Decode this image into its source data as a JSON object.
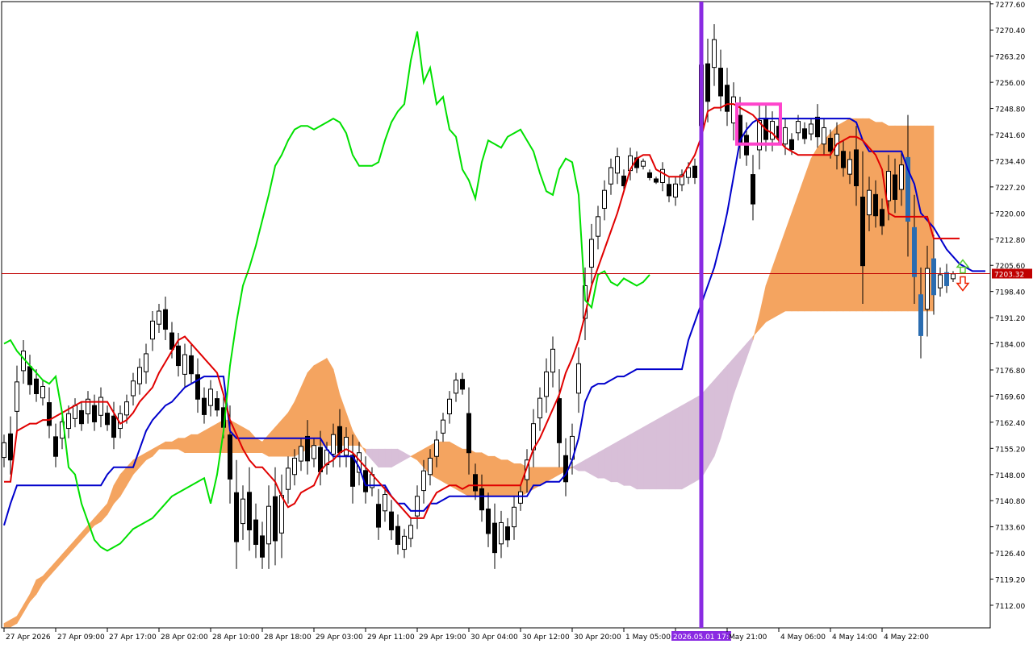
{
  "chart_data": {
    "type": "candlestick",
    "indicator": "Ichimoku Kinko Hyo",
    "ylim": [
      7106.0,
      7278.0
    ],
    "current_price": 7203.32,
    "current_price_label": "7203.32",
    "y_ticks": [
      "7277.60",
      "7270.40",
      "7263.20",
      "7256.00",
      "7248.80",
      "7241.60",
      "7234.40",
      "7227.20",
      "7220.00",
      "7212.80",
      "7205.60",
      "7198.40",
      "7191.20",
      "7184.00",
      "7176.80",
      "7169.60",
      "7162.40",
      "7155.20",
      "7148.00",
      "7140.80",
      "7133.60",
      "7126.40",
      "7119.20",
      "7112.00"
    ],
    "x_ticks": [
      "27 Apr 2026",
      "27 Apr 09:00",
      "27 Apr 17:00",
      "28 Apr 02:00",
      "28 Apr 10:00",
      "28 Apr 18:00",
      "29 Apr 03:00",
      "29 Apr 11:00",
      "29 Apr 19:00",
      "30 Apr 04:00",
      "30 Apr 12:00",
      "30 Apr 20:00",
      "1 May 05:00",
      "2026.05.01 17:00",
      "May 21:00",
      "4 May 06:00",
      "4 May 14:00",
      "4 May 22:00"
    ],
    "x_tick_slots": [
      0,
      8,
      16,
      24,
      32,
      40,
      48,
      56,
      64,
      72,
      80,
      88,
      96,
      104,
      112,
      120,
      128,
      136
    ],
    "cursor_slot": 108,
    "cursor_label": "2026.05.01 17:00",
    "total_slots": 153,
    "colors": {
      "tenkan": "#e00000",
      "kijun": "#0000cc",
      "chikou": "#00e000",
      "kumo_bull": "#f4a460",
      "kumo_bear": "#d8bfd8",
      "cursor": "#8a2be2",
      "price_line": "#c00000",
      "box": "#ff44cc",
      "arrow_up": "#55cc33",
      "arrow_down": "#ee2200",
      "axis_text": "#000000"
    },
    "candles_hl": [
      [
        7159,
        7150
      ],
      [
        7164,
        7148
      ],
      [
        7178,
        7160
      ],
      [
        7185,
        7173
      ],
      [
        7181,
        7170
      ],
      [
        7177,
        7168
      ],
      [
        7174,
        7167
      ],
      [
        7172,
        7158
      ],
      [
        7162,
        7150
      ],
      [
        7165,
        7155
      ],
      [
        7167,
        7158
      ],
      [
        7169,
        7161
      ],
      [
        7168,
        7160
      ],
      [
        7171,
        7162
      ],
      [
        7170,
        7160
      ],
      [
        7172,
        7161
      ],
      [
        7167,
        7160
      ],
      [
        7168,
        7155
      ],
      [
        7167,
        7158
      ],
      [
        7170,
        7162
      ],
      [
        7176,
        7167
      ],
      [
        7180,
        7170
      ],
      [
        7184,
        7173
      ],
      [
        7193,
        7182
      ],
      [
        7195,
        7187
      ],
      [
        7197,
        7185
      ],
      [
        7190,
        7180
      ],
      [
        7187,
        7175
      ],
      [
        7184,
        7172
      ],
      [
        7184,
        7173
      ],
      [
        7180,
        7165
      ],
      [
        7172,
        7162
      ],
      [
        7174,
        7164
      ],
      [
        7171,
        7164
      ],
      [
        7170,
        7158
      ],
      [
        7167,
        7140
      ],
      [
        7152,
        7122
      ],
      [
        7145,
        7130
      ],
      [
        7150,
        7127
      ],
      [
        7140,
        7125
      ],
      [
        7135,
        7122
      ],
      [
        7145,
        7122
      ],
      [
        7150,
        7123
      ],
      [
        7148,
        7125
      ],
      [
        7153,
        7140
      ],
      [
        7155,
        7145
      ],
      [
        7158,
        7149
      ],
      [
        7163,
        7148
      ],
      [
        7158,
        7150
      ],
      [
        7160,
        7145
      ],
      [
        7157,
        7148
      ],
      [
        7162,
        7150
      ],
      [
        7166,
        7150
      ],
      [
        7161,
        7150
      ],
      [
        7159,
        7140
      ],
      [
        7157,
        7145
      ],
      [
        7153,
        7140
      ],
      [
        7150,
        7142
      ],
      [
        7144,
        7130
      ],
      [
        7145,
        7135
      ],
      [
        7141,
        7130
      ],
      [
        7137,
        7126
      ],
      [
        7133,
        7125
      ],
      [
        7136,
        7128
      ],
      [
        7145,
        7133
      ],
      [
        7152,
        7140
      ],
      [
        7155,
        7145
      ],
      [
        7160,
        7150
      ],
      [
        7165,
        7157
      ],
      [
        7171,
        7162
      ],
      [
        7176,
        7168
      ],
      [
        7176,
        7170
      ],
      [
        7172,
        7148
      ],
      [
        7151,
        7141
      ],
      [
        7148,
        7135
      ],
      [
        7143,
        7128
      ],
      [
        7140,
        7122
      ],
      [
        7138,
        7125
      ],
      [
        7136,
        7128
      ],
      [
        7142,
        7130
      ],
      [
        7145,
        7138
      ],
      [
        7155,
        7143
      ],
      [
        7166,
        7150
      ],
      [
        7172,
        7160
      ],
      [
        7180,
        7165
      ],
      [
        7186,
        7172
      ],
      [
        7177,
        7150
      ],
      [
        7158,
        7142
      ],
      [
        7162,
        7148
      ],
      [
        7183,
        7165
      ],
      [
        7205,
        7185
      ],
      [
        7217,
        7200
      ],
      [
        7222,
        7210
      ],
      [
        7229,
        7218
      ],
      [
        7235,
        7225
      ],
      [
        7238,
        7228
      ],
      [
        7232,
        7226
      ],
      [
        7238,
        7229
      ],
      [
        7237,
        7231
      ],
      [
        7235,
        7232
      ],
      [
        7232,
        7229
      ],
      [
        7230,
        7228
      ],
      [
        7234,
        7226
      ],
      [
        7230,
        7223
      ],
      [
        7230,
        7222
      ],
      [
        7232,
        7226
      ],
      [
        7234,
        7228
      ],
      [
        7235,
        7228
      ],
      [
        7270,
        7233
      ],
      [
        7268,
        7245
      ],
      [
        7272,
        7255
      ],
      [
        7265,
        7248
      ],
      [
        7260,
        7244
      ],
      [
        7256,
        7240
      ],
      [
        7252,
        7235
      ],
      [
        7245,
        7233
      ],
      [
        7236,
        7218
      ],
      [
        7250,
        7232
      ],
      [
        7250,
        7237
      ],
      [
        7248,
        7237
      ],
      [
        7246,
        7239
      ],
      [
        7246,
        7236
      ],
      [
        7242,
        7236
      ],
      [
        7247,
        7240
      ],
      [
        7245,
        7239
      ],
      [
        7246,
        7240
      ],
      [
        7250,
        7238
      ],
      [
        7246,
        7236
      ],
      [
        7243,
        7235
      ],
      [
        7245,
        7232
      ],
      [
        7240,
        7230
      ],
      [
        7237,
        7228
      ],
      [
        7244,
        7222
      ],
      [
        7237,
        7195
      ],
      [
        7230,
        7215
      ],
      [
        7229,
        7216
      ],
      [
        7224,
        7214
      ],
      [
        7236,
        7218
      ],
      [
        7235,
        7220
      ],
      [
        7237,
        7222
      ],
      [
        7247,
        7208
      ],
      [
        7225,
        7195
      ],
      [
        7205,
        7180
      ],
      [
        7211,
        7186
      ],
      [
        7214,
        7192
      ],
      [
        7205,
        7197
      ],
      [
        7206,
        7198
      ],
      [
        7204,
        7201
      ]
    ],
    "tenkan": [
      7146,
      7146,
      7160,
      7161,
      7162,
      7162,
      7163,
      7163,
      7164,
      7165,
      7166,
      7167,
      7168,
      7168,
      7168,
      7168,
      7168,
      7165,
      7162,
      7163,
      7165,
      7168,
      7170,
      7172,
      7176,
      7179,
      7182,
      7185,
      7186,
      7184,
      7182,
      7180,
      7178,
      7176,
      7170,
      7163,
      7159,
      7155,
      7152,
      7150,
      7150,
      7148,
      7146,
      7142,
      7139,
      7140,
      7143,
      7144,
      7145,
      7149,
      7151,
      7152,
      7154,
      7155,
      7154,
      7152,
      7150,
      7148,
      7146,
      7144,
      7142,
      7140,
      7138,
      7136,
      7136,
      7136,
      7140,
      7143,
      7144,
      7145,
      7145,
      7144,
      7145,
      7145,
      7145,
      7145,
      7145,
      7145,
      7145,
      7145,
      7145,
      7150,
      7155,
      7158,
      7162,
      7166,
      7170,
      7176,
      7180,
      7185,
      7192,
      7200,
      7205,
      7210,
      7215,
      7220,
      7226,
      7232,
      7235,
      7236,
      7236,
      7232,
      7231,
      7230,
      7230,
      7230,
      7233,
      7236,
      7241,
      7248,
      7249,
      7249,
      7250,
      7250,
      7249,
      7248,
      7247,
      7245,
      7243,
      7242,
      7240,
      7238,
      7237,
      7236,
      7236,
      7236,
      7236,
      7236,
      7236,
      7239,
      7240,
      7241,
      7241,
      7240,
      7238,
      7236,
      7232,
      7220,
      7219,
      7219,
      7219,
      7219,
      7219,
      7219,
      7213,
      7213,
      7213,
      7213,
      7213
    ],
    "kijun": [
      7134,
      7140,
      7145,
      7145,
      7145,
      7145,
      7145,
      7145,
      7145,
      7145,
      7145,
      7145,
      7145,
      7145,
      7145,
      7145,
      7148,
      7150,
      7150,
      7150,
      7150,
      7155,
      7160,
      7163,
      7165,
      7167,
      7168,
      7170,
      7172,
      7173,
      7174,
      7175,
      7175,
      7175,
      7175,
      7160,
      7158,
      7158,
      7158,
      7158,
      7158,
      7158,
      7158,
      7158,
      7158,
      7158,
      7158,
      7158,
      7158,
      7158,
      7155,
      7153,
      7153,
      7153,
      7153,
      7150,
      7145,
      7145,
      7145,
      7145,
      7142,
      7140,
      7140,
      7138,
      7138,
      7138,
      7140,
      7140,
      7141,
      7142,
      7142,
      7142,
      7142,
      7142,
      7142,
      7142,
      7142,
      7142,
      7142,
      7142,
      7142,
      7142,
      7145,
      7145,
      7146,
      7146,
      7146,
      7148,
      7152,
      7158,
      7168,
      7172,
      7173,
      7173,
      7174,
      7175,
      7175,
      7176,
      7177,
      7177,
      7177,
      7177,
      7177,
      7177,
      7177,
      7177,
      7185,
      7190,
      7195,
      7200,
      7205,
      7212,
      7220,
      7230,
      7240,
      7243,
      7245,
      7246,
      7246,
      7246,
      7246,
      7246,
      7246,
      7246,
      7246,
      7246,
      7246,
      7246,
      7246,
      7246,
      7246,
      7246,
      7245,
      7240,
      7237,
      7237,
      7237,
      7237,
      7237,
      7237,
      7232,
      7228,
      7220,
      7218,
      7216,
      7213,
      7210,
      7208,
      7206,
      7205,
      7204,
      7204,
      7204
    ],
    "chikou": [
      7184,
      7185,
      7182,
      7180,
      7178,
      7176,
      7174,
      7173,
      7175,
      7165,
      7150,
      7148,
      7140,
      7135,
      7130,
      7128,
      7127,
      7128,
      7129,
      7131,
      7133,
      7134,
      7135,
      7136,
      7138,
      7140,
      7142,
      7143,
      7144,
      7145,
      7146,
      7147,
      7140,
      7148,
      7160,
      7178,
      7190,
      7200,
      7205,
      7211,
      7218,
      7225,
      7233,
      7236,
      7240,
      7243,
      7244,
      7244,
      7243,
      7244,
      7245,
      7246,
      7245,
      7242,
      7236,
      7233,
      7233,
      7233,
      7234,
      7240,
      7245,
      7248,
      7250,
      7262,
      7270,
      7256,
      7260,
      7250,
      7252,
      7243,
      7241,
      7232,
      7229,
      7224,
      7234,
      7240,
      7239,
      7238,
      7241,
      7242,
      7243,
      7240,
      7237,
      7231,
      7226,
      7225,
      7232,
      7235,
      7234,
      7225,
      7196,
      7194,
      7203,
      7204,
      7201,
      7200,
      7202,
      7201,
      7200,
      7201,
      7203
    ],
    "span_a": [
      7107,
      7108,
      7109,
      7112,
      7115,
      7119,
      7120,
      7122,
      7124,
      7126,
      7128,
      7130,
      7132,
      7134,
      7136,
      7138,
      7140,
      7145,
      7148,
      7150,
      7152,
      7153,
      7154,
      7155,
      7156,
      7157,
      7157,
      7158,
      7158,
      7159,
      7159,
      7160,
      7161,
      7162,
      7163,
      7163,
      7162,
      7161,
      7160,
      7158,
      7157,
      7159,
      7161,
      7163,
      7165,
      7168,
      7172,
      7176,
      7178,
      7179,
      7180,
      7177,
      7170,
      7165,
      7160,
      7157,
      7154,
      7152,
      7150,
      7150,
      7150,
      7151,
      7152,
      7153,
      7154,
      7155,
      7156,
      7157,
      7157,
      7157,
      7156,
      7155,
      7155,
      7154,
      7154,
      7153,
      7153,
      7152,
      7152,
      7151,
      7151,
      7150,
      7150,
      7150,
      7150,
      7150,
      7150,
      7150,
      7150,
      7149,
      7149,
      7148,
      7147,
      7147,
      7146,
      7146,
      7145,
      7145,
      7144,
      7144,
      7144,
      7144,
      7144,
      7144,
      7144,
      7144,
      7145,
      7146,
      7147,
      7150,
      7153,
      7158,
      7164,
      7170,
      7175,
      7180,
      7185,
      7192,
      7200,
      7205,
      7210,
      7215,
      7220,
      7225,
      7230,
      7235,
      7238,
      7240,
      7242,
      7244,
      7245,
      7246,
      7246,
      7246,
      7246,
      7245,
      7245,
      7244,
      7244,
      7244,
      7244,
      7244,
      7244,
      7244,
      7244
    ],
    "span_b": [
      7106,
      7106,
      7107,
      7110,
      7113,
      7115,
      7118,
      7120,
      7122,
      7124,
      7126,
      7128,
      7130,
      7132,
      7134,
      7135,
      7137,
      7140,
      7142,
      7145,
      7148,
      7150,
      7152,
      7153,
      7155,
      7155,
      7155,
      7155,
      7154,
      7154,
      7154,
      7154,
      7154,
      7154,
      7154,
      7154,
      7154,
      7154,
      7154,
      7154,
      7154,
      7153,
      7153,
      7153,
      7153,
      7153,
      7154,
      7155,
      7156,
      7156,
      7156,
      7156,
      7156,
      7156,
      7156,
      7156,
      7155,
      7155,
      7155,
      7155,
      7155,
      7155,
      7154,
      7153,
      7152,
      7150,
      7148,
      7147,
      7146,
      7145,
      7144,
      7143,
      7142,
      7142,
      7142,
      7142,
      7142,
      7142,
      7142,
      7142,
      7142,
      7143,
      7144,
      7145,
      7146,
      7147,
      7148,
      7149,
      7150,
      7151,
      7152,
      7153,
      7154,
      7155,
      7156,
      7157,
      7158,
      7159,
      7160,
      7161,
      7162,
      7163,
      7164,
      7165,
      7166,
      7167,
      7168,
      7169,
      7170,
      7172,
      7174,
      7176,
      7178,
      7180,
      7182,
      7184,
      7186,
      7188,
      7190,
      7191,
      7192,
      7193,
      7193,
      7193,
      7193,
      7193,
      7193,
      7193,
      7193,
      7193,
      7193,
      7193,
      7193,
      7193,
      7193,
      7193,
      7193,
      7193,
      7193,
      7193,
      7193,
      7193,
      7193,
      7193,
      7193
    ]
  }
}
